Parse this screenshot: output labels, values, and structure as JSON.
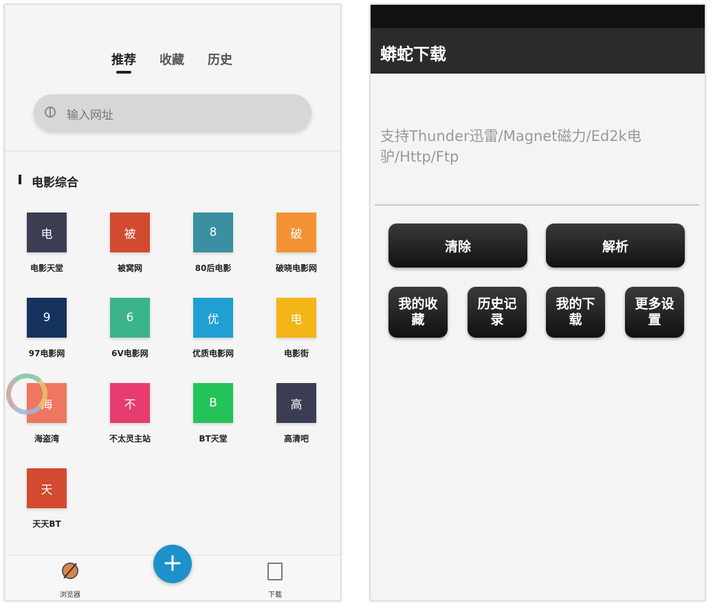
{
  "left": {
    "tabs": [
      {
        "label": "推荐",
        "active": true
      },
      {
        "label": "收藏",
        "active": false
      },
      {
        "label": "历史",
        "active": false
      }
    ],
    "search_placeholder": "输入网址",
    "section_title": "电影综合",
    "sites": [
      {
        "icon_char": "电",
        "label": "电影天堂",
        "color": "#3b3d52"
      },
      {
        "icon_char": "被",
        "label": "被窝网",
        "color": "#d24a2f"
      },
      {
        "icon_char": "8",
        "label": "80后电影",
        "color": "#3a8fa0"
      },
      {
        "icon_char": "破",
        "label": "破晓电影网",
        "color": "#f39234"
      },
      {
        "icon_char": "9",
        "label": "97电影网",
        "color": "#16325e"
      },
      {
        "icon_char": "6",
        "label": "6V电影网",
        "color": "#3bb48a"
      },
      {
        "icon_char": "优",
        "label": "优质电影网",
        "color": "#1f9fd2"
      },
      {
        "icon_char": "电",
        "label": "电影街",
        "color": "#f4b516"
      },
      {
        "icon_char": "海",
        "label": "海盗湾",
        "color": "#ef7660"
      },
      {
        "icon_char": "不",
        "label": "不太灵主站",
        "color": "#e63c6f"
      },
      {
        "icon_char": "B",
        "label": "BT天堂",
        "color": "#24c35a"
      },
      {
        "icon_char": "高",
        "label": "高清吧",
        "color": "#3b3d52"
      },
      {
        "icon_char": "天",
        "label": "天天BT",
        "color": "#d24a2f"
      }
    ],
    "bottom_nav": {
      "browser_label": "浏览器",
      "fab_label": "+",
      "download_label": "下载"
    }
  },
  "right": {
    "app_title": "蟒蛇下载",
    "support_text": "支持Thunder迅雷/Magnet磁力/Ed2k电驴/Http/Ftp",
    "clear_label": "清除",
    "parse_label": "解析",
    "favorites_label": "我的收藏",
    "history_label": "历史记录",
    "downloads_label": "我的下载",
    "settings_label": "更多设置"
  }
}
